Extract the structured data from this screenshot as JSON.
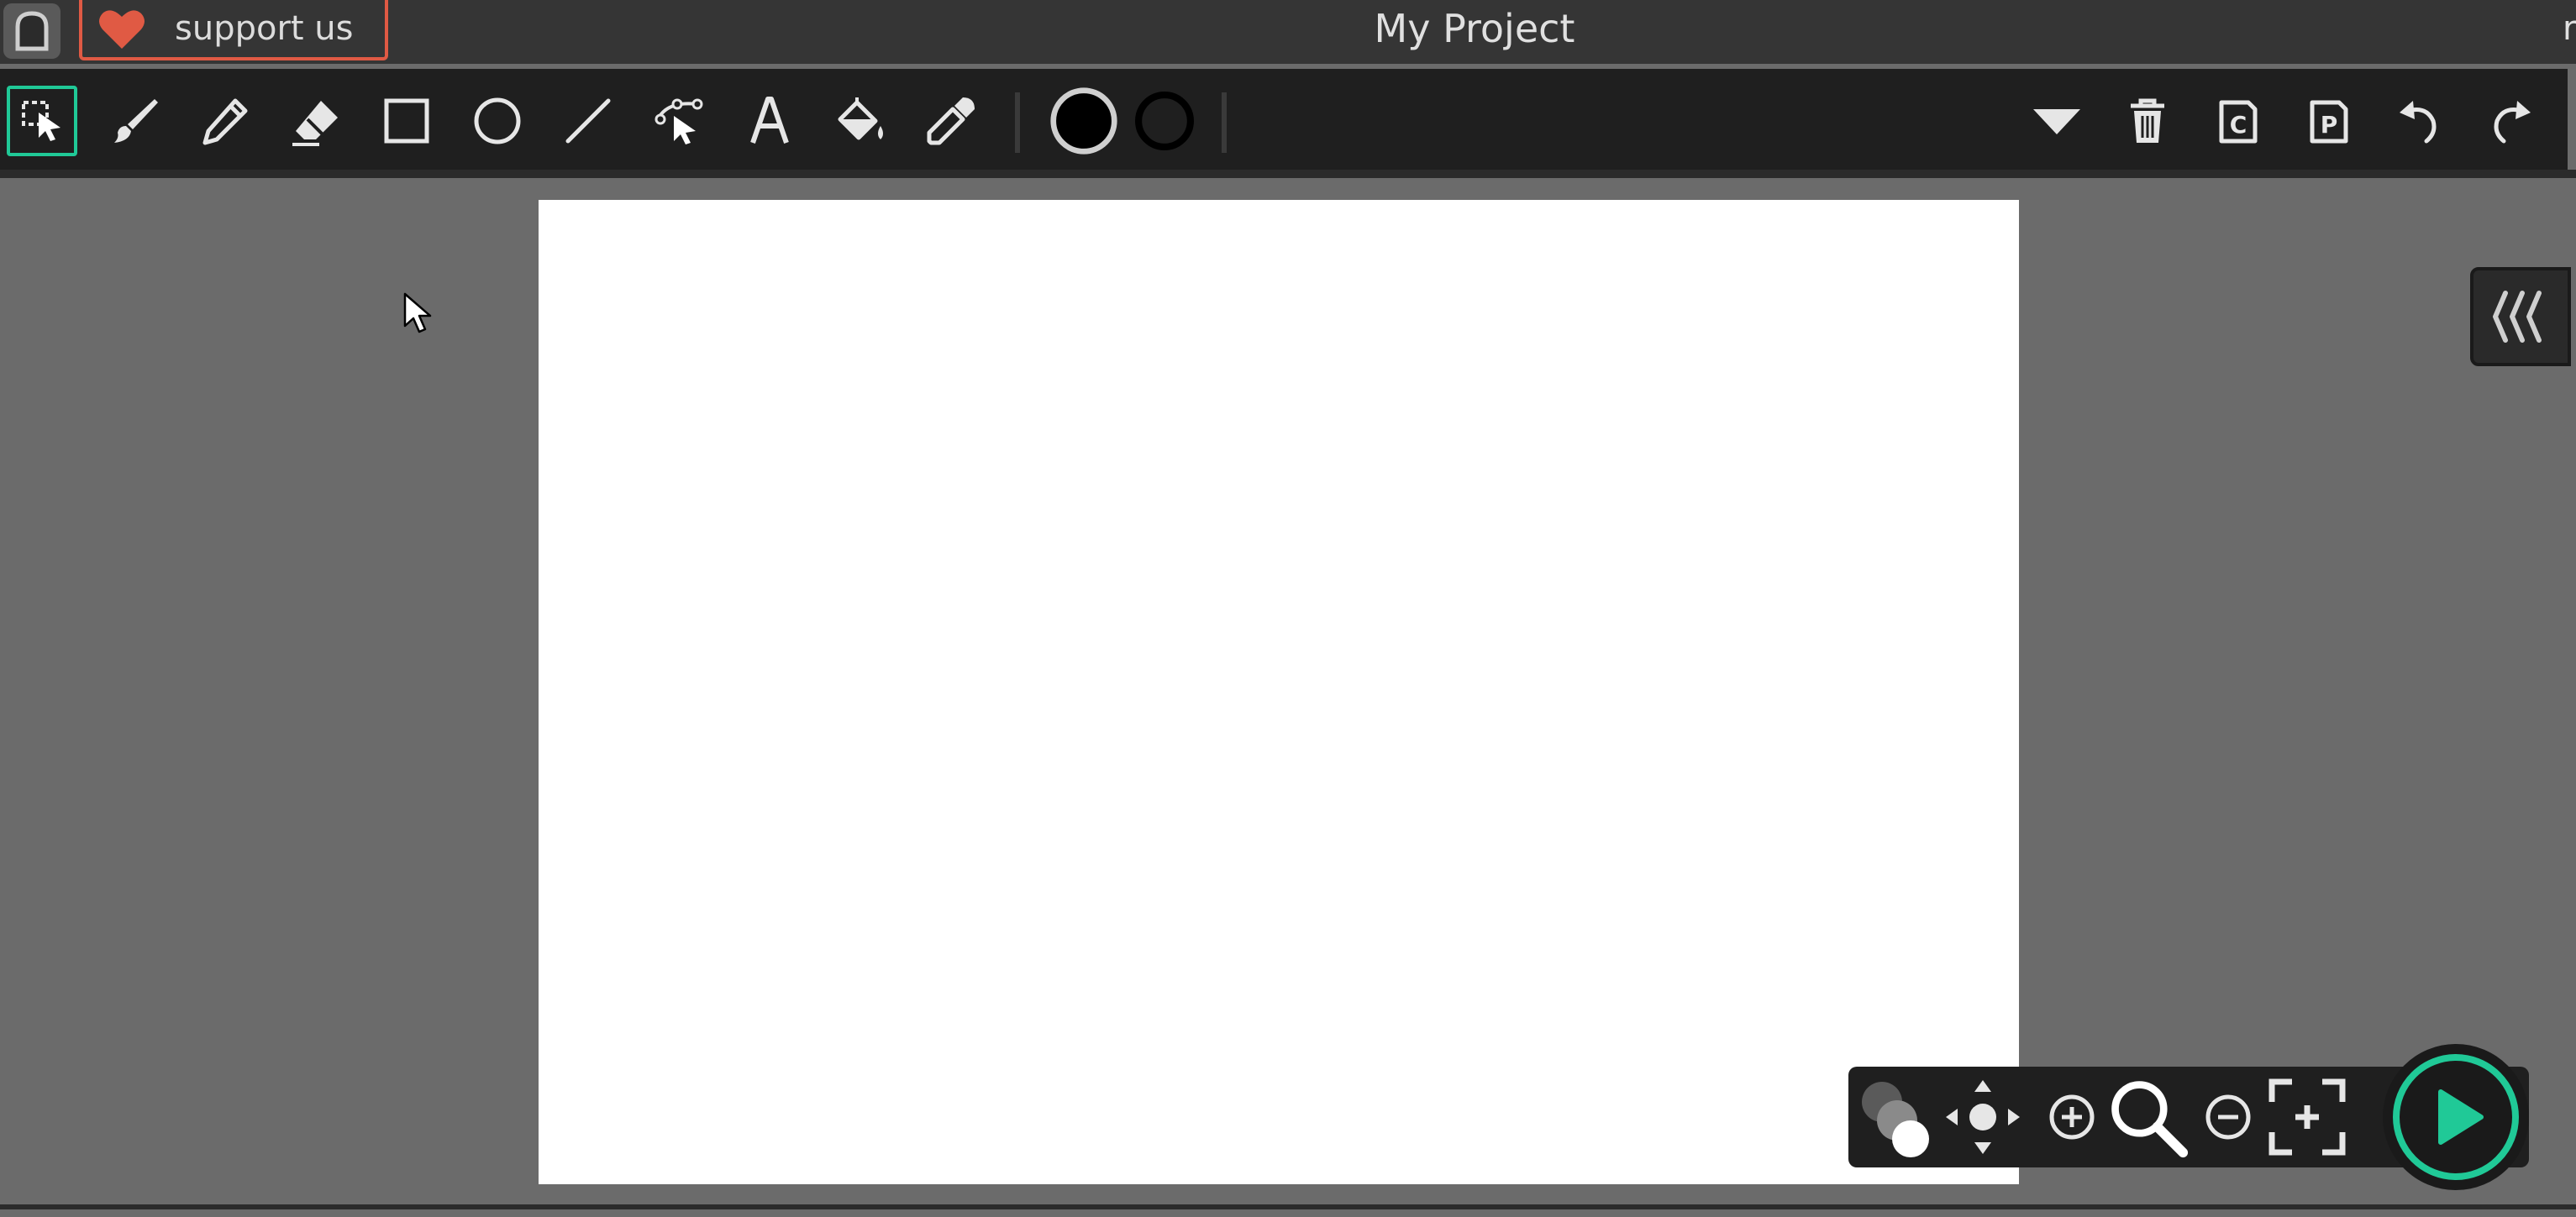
{
  "header": {
    "support_label": "support us",
    "project_title": "My Project",
    "edge_text": "r"
  },
  "toolbar": {
    "tools": [
      {
        "name": "select-tool",
        "icon": "select-pointer-icon",
        "active": true
      },
      {
        "name": "brush-tool",
        "icon": "brush-icon"
      },
      {
        "name": "pencil-tool",
        "icon": "pencil-icon"
      },
      {
        "name": "eraser-tool",
        "icon": "eraser-icon"
      },
      {
        "name": "rectangle-tool",
        "icon": "rectangle-icon"
      },
      {
        "name": "ellipse-tool",
        "icon": "circle-icon"
      },
      {
        "name": "line-tool",
        "icon": "line-icon"
      },
      {
        "name": "path-edit-tool",
        "icon": "path-pointer-icon"
      },
      {
        "name": "text-tool",
        "icon": "text-icon"
      },
      {
        "name": "fill-tool",
        "icon": "paint-bucket-icon"
      },
      {
        "name": "eyedropper-tool",
        "icon": "eyedropper-icon"
      }
    ],
    "fill_color": "#000000",
    "stroke_color": "#000000",
    "actions": [
      "dropdown",
      "delete",
      "copy",
      "paste",
      "undo",
      "redo"
    ]
  },
  "colors": {
    "accent": "#20c997",
    "support_border": "#e05a44",
    "header_bg": "#353535",
    "toolbar_bg": "#1f1f1f",
    "workspace_bg": "#6b6b6b",
    "canvas_bg": "#ffffff"
  },
  "view_controls": [
    "onion-skin",
    "pan",
    "zoom-in",
    "zoom",
    "zoom-out",
    "fit-screen",
    "play"
  ]
}
